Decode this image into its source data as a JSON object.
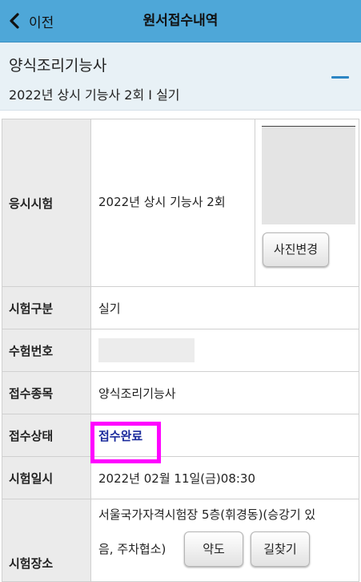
{
  "header": {
    "back_label": "이전",
    "title": "원서접수내역"
  },
  "summary": {
    "name": "양식조리기능사",
    "detail": "2022년 상시 기능사 2회 I 실기"
  },
  "table": {
    "exam_label": "응시시험",
    "exam_value": "2022년 상시 기능사 2회",
    "photo_button": "사진변경",
    "type_label": "시험구분",
    "type_value": "실기",
    "number_label": "수험번호",
    "category_label": "접수종목",
    "category_value": "양식조리기능사",
    "status_label": "접수상태",
    "status_value": "접수완료",
    "date_label": "시험일시",
    "date_value": "2022년 02월 11일(금)08:30",
    "place_label": "시험장소",
    "place_line1": "서울국가자격시험장 5층(휘경동)(승강기 있",
    "place_line2": "음, 주차협소)",
    "map_button": "약도",
    "route_button": "길찾기"
  },
  "colors": {
    "header_bg": "#4ea7d8",
    "summary_bg": "#e8f1f6",
    "status_text": "#1a2a9c",
    "highlight": "#ff00ff"
  }
}
